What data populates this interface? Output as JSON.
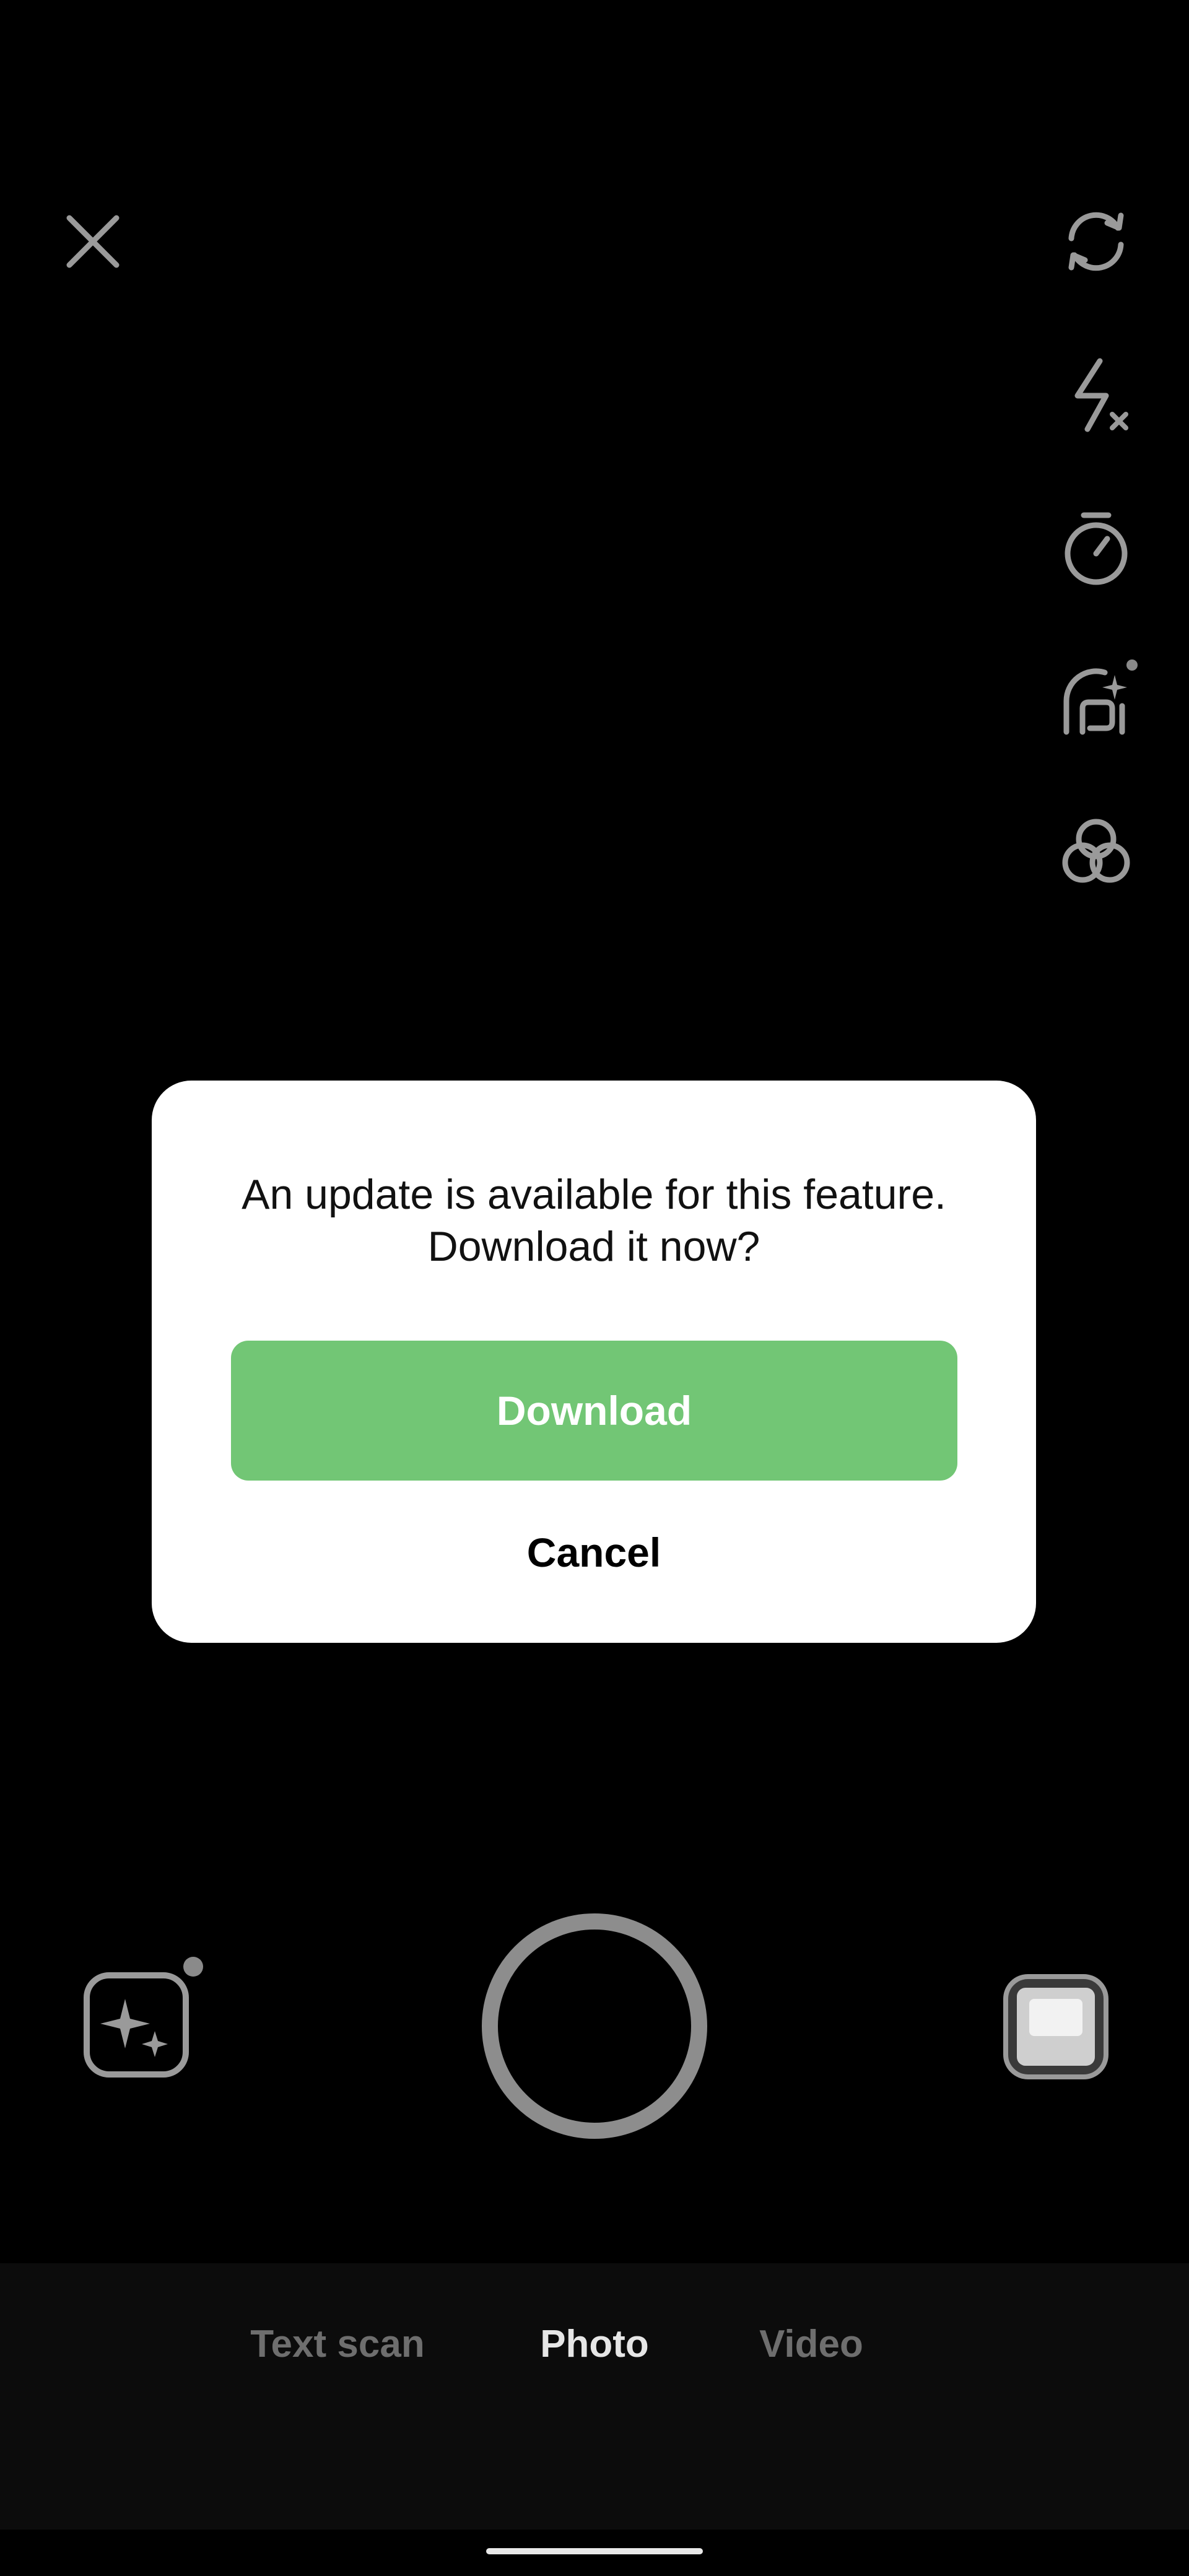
{
  "top_bar": {
    "close_icon": "close-icon"
  },
  "right_rail": {
    "icons": [
      "rotate-camera-icon",
      "flash-off-icon",
      "timer-icon",
      "face-effects-icon",
      "filters-icon"
    ]
  },
  "dialog": {
    "message": "An update is available for this feature. Download it now?",
    "download_label": "Download",
    "cancel_label": "Cancel",
    "accent_color": "#72c675"
  },
  "bottom_controls": {
    "left_icon": "sparkle-effects-icon",
    "shutter": "shutter-button",
    "right_icon": "gallery-thumbnail"
  },
  "modes": {
    "items": [
      {
        "label": "Text scan",
        "active": false
      },
      {
        "label": "Photo",
        "active": true
      },
      {
        "label": "Video",
        "active": false
      }
    ]
  }
}
